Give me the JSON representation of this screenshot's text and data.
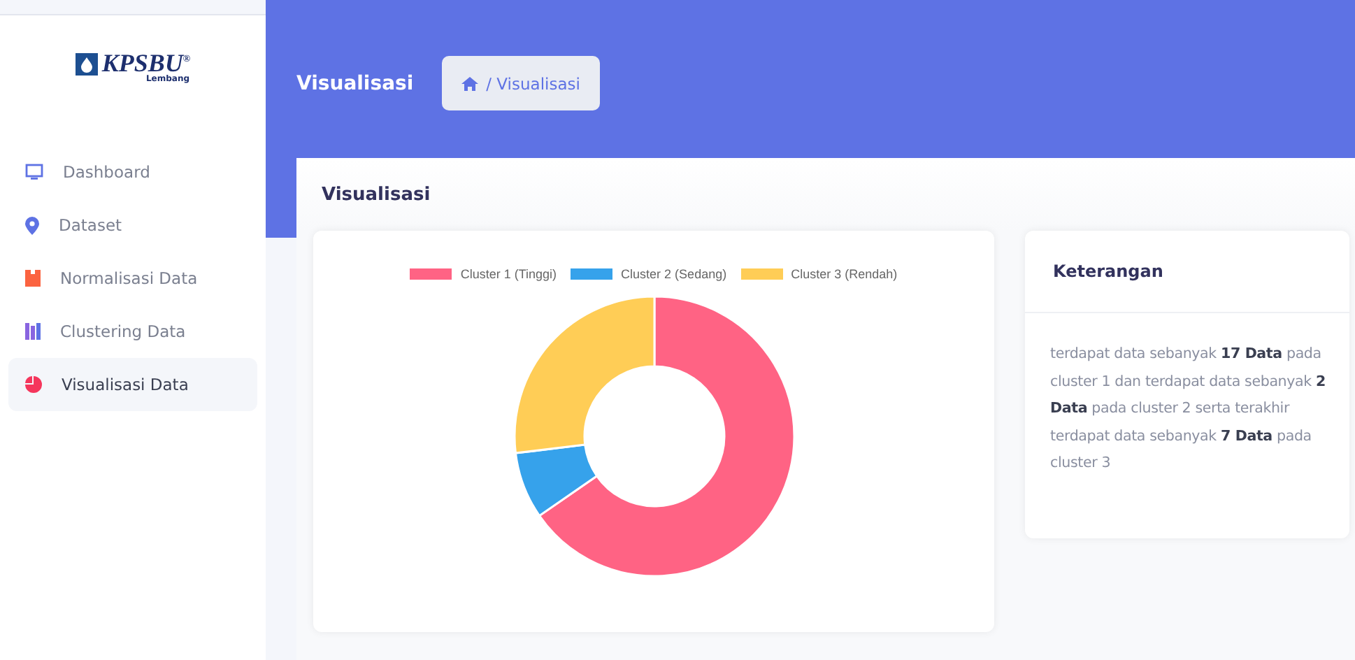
{
  "logo": {
    "name": "KPSBU",
    "mark": "®",
    "sub": "Lembang"
  },
  "sidebar": {
    "items": [
      {
        "label": "Dashboard",
        "kind": "monitor",
        "selected": false
      },
      {
        "label": "Dataset",
        "kind": "pin",
        "selected": false
      },
      {
        "label": "Normalisasi Data",
        "kind": "book",
        "selected": false
      },
      {
        "label": "Clustering Data",
        "kind": "bars",
        "selected": false
      },
      {
        "label": "Visualisasi Data",
        "kind": "pie",
        "selected": true
      }
    ]
  },
  "header": {
    "title": "Visualisasi",
    "breadcrumb": "/ Visualisasi"
  },
  "card": {
    "title": "Visualisasi",
    "chart_data": {
      "type": "donut",
      "categories": [
        "Cluster 1 (Tinggi)",
        "Cluster 2 (Sedang)",
        "Cluster 3 (Rendah)"
      ],
      "values": [
        17,
        2,
        7
      ],
      "colors": [
        "#ff6384",
        "#36a2eb",
        "#ffcd56"
      ]
    }
  },
  "info": {
    "title": "Keterangan",
    "text": "terdapat data sebanyak **17 Data** pada cluster 1 dan terdapat data sebanyak **2 Data** pada cluster 2 serta terakhir terdapat data sebanyak **7 Data** pada cluster 3"
  }
}
